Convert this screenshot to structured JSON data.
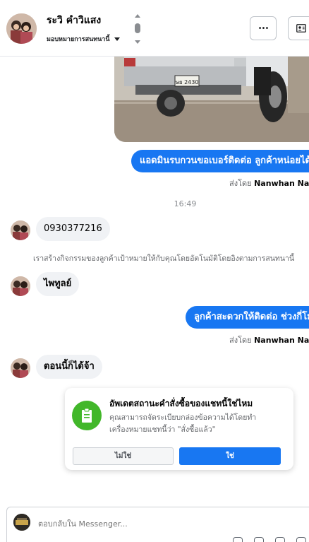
{
  "header": {
    "contact_name": "ระวิ คำวิแสง",
    "assign_label": "มอบหมายการสนทนานี้",
    "more_label": "•••"
  },
  "messages": {
    "out1": "แอดมินรบกวนขอเบอร์ติดต่อ ลูกค้าหน่อยได้ไหม",
    "sent_by_label": "ส่งโดย",
    "sender_name": "Nanwhan Na",
    "time": "16:49",
    "in1": "0930377216",
    "system_note": "เราสร้างกิจกรรมของลูกค้าเป้าหมายให้กับคุณโดยอัตโนมัติโดยอิงตามการสนทนานี้",
    "in2": "ไพทูลย์",
    "out2": "ลูกค้าสะดวกให้ติดต่อ ช่วงกี่โมง",
    "in3": "ตอนนี้ก็ได้จ้า"
  },
  "card": {
    "title": "อัพเดตสถานะคำสั่งซื้อของแชทนี้ใช่ไหม",
    "body": "คุณสามารถจัดระเบียบกล่องข้อความได้โดยทำเครื่องหมายแชทนี้ว่า \"สั่งซื้อแล้ว\"",
    "no_label": "ไม่ใช่",
    "yes_label": "ใช่"
  },
  "photo": {
    "plate_text": "ษย 2430"
  },
  "reply": {
    "placeholder": "ตอบกลับใน Messenger..."
  },
  "colors": {
    "accent": "#1877f2",
    "bubble_in": "#f0f2f5",
    "card_icon": "#42b72a"
  },
  "icons": [
    "chevron-up-icon",
    "chevron-down-icon",
    "more-icon",
    "profile-card-icon",
    "order-icon"
  ]
}
